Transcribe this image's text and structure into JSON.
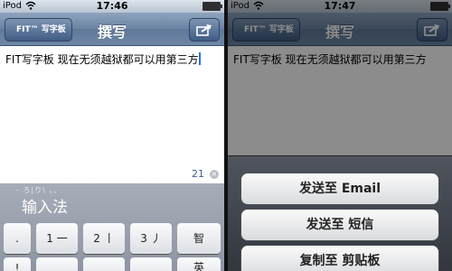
{
  "left": {
    "status": {
      "carrier": "iPod",
      "time": "17:46"
    },
    "nav": {
      "back_label": "FIT™ 写字板",
      "title": "撰写"
    },
    "editor": {
      "text": "FIT写字板  现在无须越狱都可以用第三方",
      "char_count": "21"
    },
    "ime": {
      "hint": "- ろ|り\\ 、、",
      "label": "输入法",
      "keys": [
        ".",
        "1 一",
        "2 丨",
        "3 丿",
        "智",
        "!",
        "",
        "",
        "",
        "英"
      ]
    }
  },
  "right": {
    "status": {
      "carrier": "iPod",
      "time": "17:47"
    },
    "nav": {
      "back_label": "FIT™ 写字板",
      "title": "撰写"
    },
    "editor": {
      "text": "FIT写字板  现在无须越狱都可以用第三方"
    },
    "sheet": {
      "buttons": [
        "发送至 Email",
        "发送至 短信",
        "复制至 剪贴板"
      ]
    }
  }
}
